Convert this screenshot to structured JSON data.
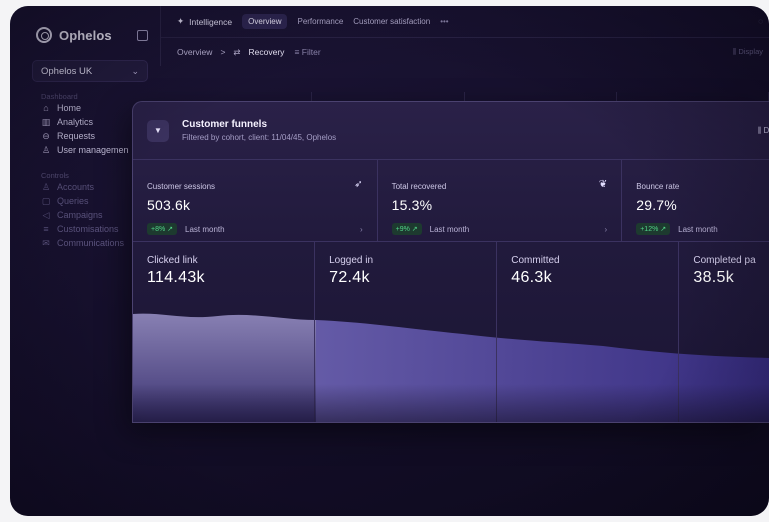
{
  "brand": {
    "name": "Ophelos"
  },
  "org_select": {
    "value": "Ophelos UK"
  },
  "sidebar": {
    "section_dashboard": "Dashboard",
    "main_items": [
      {
        "label": "Home",
        "icon": "home-icon"
      },
      {
        "label": "Analytics",
        "icon": "bar-chart-icon"
      },
      {
        "label": "Requests",
        "icon": "inbox-icon"
      },
      {
        "label": "User managemen",
        "icon": "user-icon"
      }
    ],
    "section_controls": "Controls",
    "control_items": [
      {
        "label": "Accounts",
        "icon": "users-icon"
      },
      {
        "label": "Queries",
        "icon": "message-icon"
      },
      {
        "label": "Campaigns",
        "icon": "megaphone-icon"
      },
      {
        "label": "Customisations",
        "icon": "sliders-icon"
      },
      {
        "label": "Communications",
        "icon": "mail-icon"
      }
    ]
  },
  "header": {
    "section": "Intelligence",
    "tabs": [
      "Overview",
      "Performance",
      "Customer satisfaction"
    ],
    "active_tab": "Overview",
    "more": "•••",
    "breadcrumb_root": "Overview",
    "breadcrumb_sep": ">",
    "breadcrumb_current": "Recovery",
    "filter_label": "Filter",
    "display_label": "Display"
  },
  "card": {
    "title": "Customer funnels",
    "subtitle": "Filtered by cohort, client: 11/04/45, Ophelos",
    "display_label": "Di",
    "stats": [
      {
        "label": "Customer sessions",
        "value": "503.6k",
        "delta": "+8% ↗",
        "period": "Last month",
        "icon": "cursor-click-icon"
      },
      {
        "label": "Total recovered",
        "value": "15.3%",
        "delta": "+9% ↗",
        "period": "Last month",
        "icon": "coins-hand-icon"
      },
      {
        "label": "Bounce rate",
        "value": "29.7%",
        "delta": "+12% ↗",
        "period": "Last month",
        "icon": ""
      }
    ],
    "funnel": [
      {
        "label": "Clicked link",
        "value": "114.43k"
      },
      {
        "label": "Logged in",
        "value": "72.4k"
      },
      {
        "label": "Committed",
        "value": "46.3k"
      },
      {
        "label": "Completed pa",
        "value": "38.5k"
      }
    ]
  },
  "colors": {
    "accent": "#6a5fd0",
    "positive": "#52d68a",
    "background": "#150f2b"
  }
}
